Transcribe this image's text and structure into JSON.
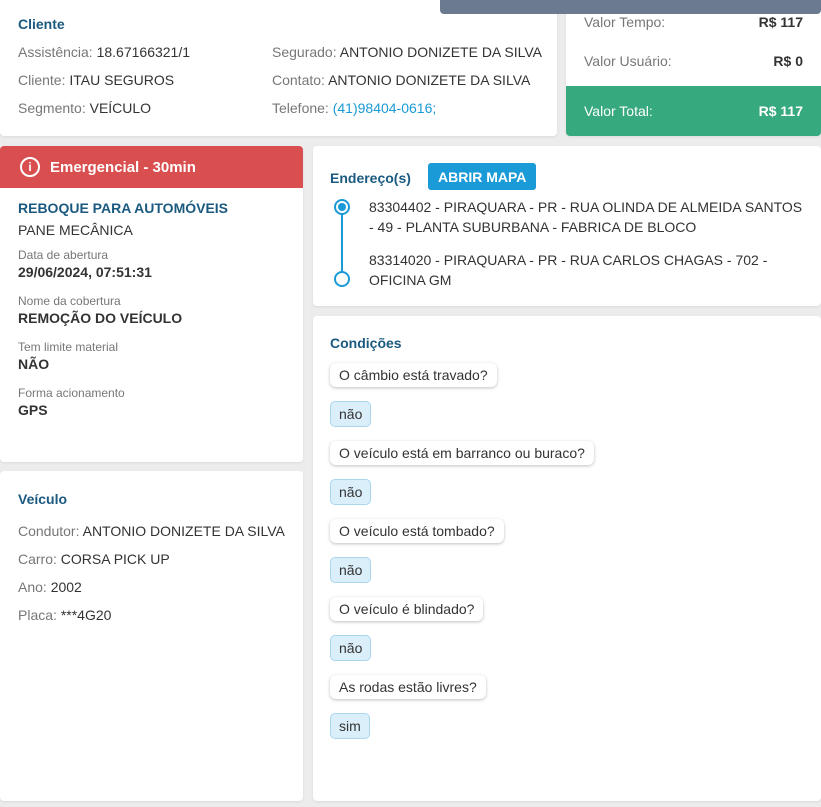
{
  "cliente": {
    "title": "Cliente",
    "rows": [
      {
        "label": "Assistência:",
        "value": "18.67166321/1"
      },
      {
        "label": "Cliente:",
        "value": "ITAU SEGUROS"
      },
      {
        "label": "Segmento:",
        "value": "VEÍCULO"
      },
      {
        "label": "Segurado:",
        "value": "ANTONIO DONIZETE DA SILVA"
      },
      {
        "label": "Contato:",
        "value": "ANTONIO DONIZETE DA SILVA"
      },
      {
        "label": "Telefone:",
        "value": "(41)98404-0616;"
      }
    ]
  },
  "valores": {
    "tempo_label": "Valor Tempo:",
    "tempo": "R$ 117",
    "usuario_label": "Valor Usuário:",
    "usuario": "R$ 0",
    "total_label": "Valor Total:",
    "total": "R$ 117"
  },
  "servico": {
    "badge": "Emergencial - 30min",
    "tipo": "REBOQUE PARA AUTOMÓVEIS",
    "motivo": "PANE MECÂNICA",
    "fields": [
      {
        "label": "Data de abertura",
        "value": "29/06/2024, 07:51:31"
      },
      {
        "label": "Nome da cobertura",
        "value": "REMOÇÃO DO VEÍCULO"
      },
      {
        "label": "Tem limite material",
        "value": "NÃO"
      },
      {
        "label": "Forma acionamento",
        "value": "GPS"
      }
    ]
  },
  "veiculo": {
    "title": "Veículo",
    "rows": [
      {
        "label": "Condutor:",
        "value": "ANTONIO DONIZETE DA SILVA"
      },
      {
        "label": "Carro:",
        "value": "CORSA PICK UP"
      },
      {
        "label": "Ano:",
        "value": "2002"
      },
      {
        "label": "Placa:",
        "value": "***4G20"
      }
    ]
  },
  "enderecos": {
    "title": "Endereço(s)",
    "button": "ABRIR MAPA",
    "items": [
      "83304402 - PIRAQUARA - PR - RUA OLINDA DE ALMEIDA SANTOS - 49 - PLANTA SUBURBANA - FABRICA DE BLOCO",
      "83314020 - PIRAQUARA - PR - RUA CARLOS CHAGAS - 702 - OFICINA GM"
    ]
  },
  "condicoes": {
    "title": "Condições",
    "items": [
      {
        "q": "O câmbio está travado?",
        "a": "não"
      },
      {
        "q": "O veículo está em barranco ou buraco?",
        "a": "não"
      },
      {
        "q": "O veículo está tombado?",
        "a": "não"
      },
      {
        "q": "O veículo é blindado?",
        "a": "não"
      },
      {
        "q": "As rodas estão livres?",
        "a": "sim"
      }
    ]
  },
  "colors": {
    "green": "#36a97e",
    "red": "#d94f4f",
    "accent": "#1a9ad6"
  }
}
